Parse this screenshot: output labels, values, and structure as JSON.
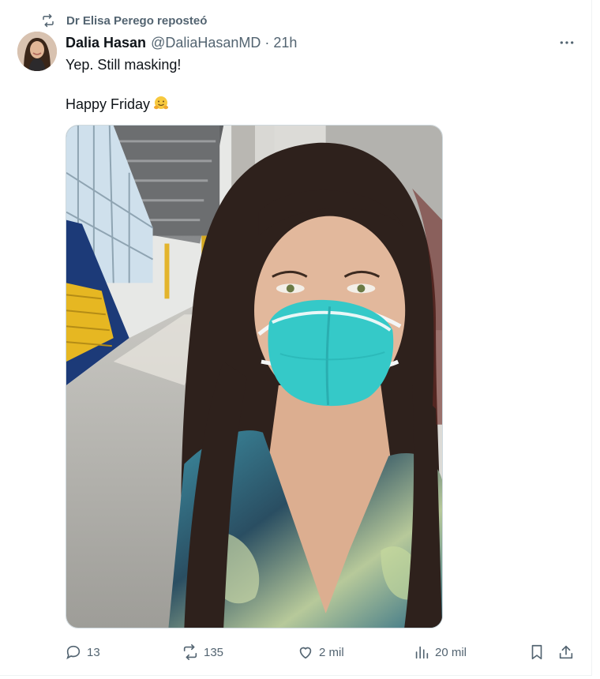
{
  "repost": {
    "label": "Dr Elisa Perego reposteó",
    "icon": "repost-icon"
  },
  "tweet": {
    "author_name": "Dalia Hasan",
    "author_handle": "@DaliaHasanMD",
    "separator": "·",
    "time": "21h",
    "text_line1": "Yep. Still masking!",
    "text_line2": "Happy Friday",
    "emoji": "hugging-face-emoji",
    "media_alt": "Selfie of a woman with long dark hair wearing a teal N95 mask in a bright corridor"
  },
  "actions": {
    "replies": "13",
    "reposts": "135",
    "likes": "2 mil",
    "views": "20 mil"
  },
  "colors": {
    "text_primary": "#0f1419",
    "text_secondary": "#536471",
    "mask_teal": "#35c9c8",
    "border": "#cfd9de"
  }
}
